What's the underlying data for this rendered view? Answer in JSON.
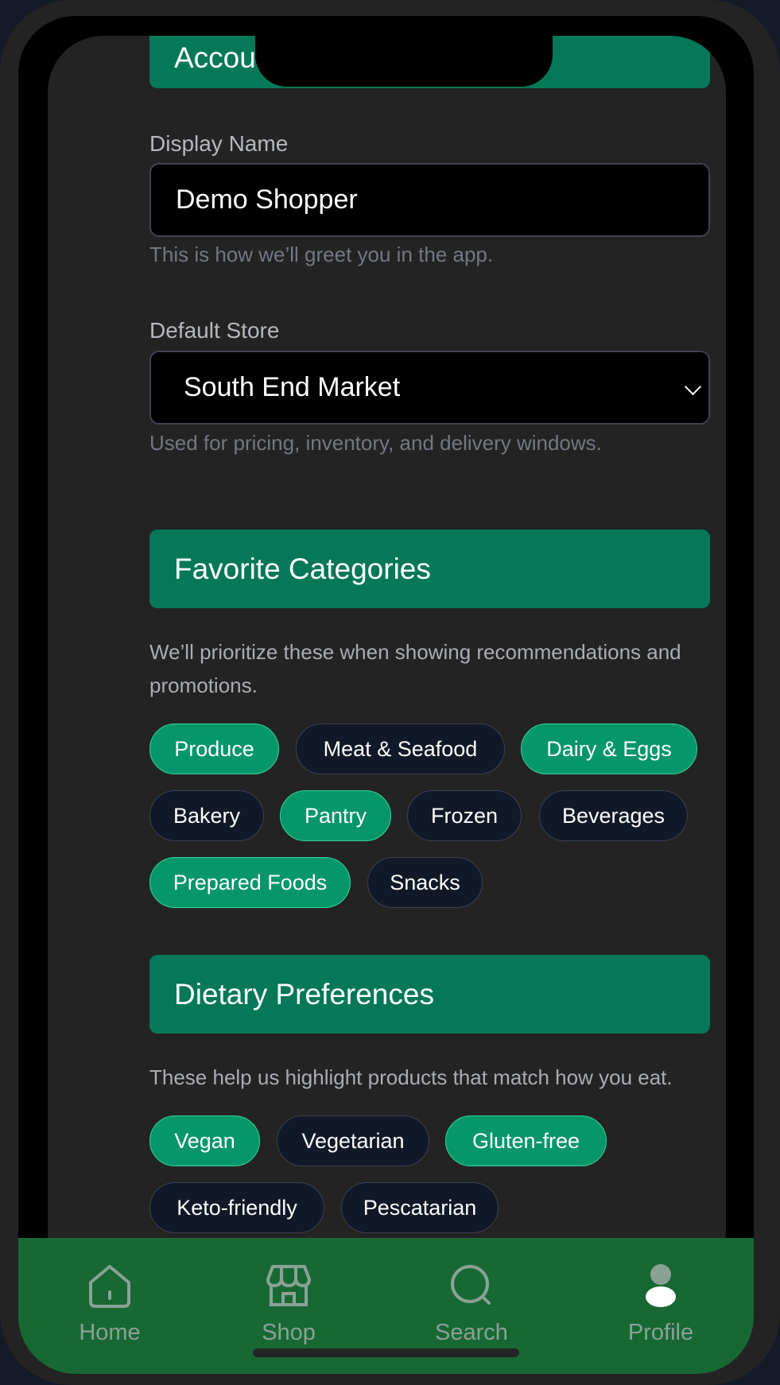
{
  "account": {
    "header_partial": "Account"
  },
  "display_name": {
    "label": "Display Name",
    "value": "Demo Shopper",
    "help": "This is how we’ll greet you in the app."
  },
  "default_store": {
    "label": "Default Store",
    "value": "South End Market",
    "help": "Used for pricing, inventory, and delivery windows."
  },
  "favorite_categories": {
    "title": "Favorite Categories",
    "description": "We’ll prioritize these when showing recommendations and promotions.",
    "chips": [
      {
        "label": "Produce",
        "selected": true
      },
      {
        "label": "Meat & Seafood",
        "selected": false
      },
      {
        "label": "Dairy & Eggs",
        "selected": true
      },
      {
        "label": "Bakery",
        "selected": false
      },
      {
        "label": "Pantry",
        "selected": true
      },
      {
        "label": "Frozen",
        "selected": false
      },
      {
        "label": "Beverages",
        "selected": false
      },
      {
        "label": "Prepared Foods",
        "selected": true
      },
      {
        "label": "Snacks",
        "selected": false
      }
    ]
  },
  "dietary_preferences": {
    "title": "Dietary Preferences",
    "description": "These help us highlight products that match how you eat.",
    "chips": [
      {
        "label": "Vegan",
        "selected": true
      },
      {
        "label": "Vegetarian",
        "selected": false
      },
      {
        "label": "Gluten-free",
        "selected": true
      },
      {
        "label": "Keto-friendly",
        "selected": false
      },
      {
        "label": "Pescatarian",
        "selected": false
      }
    ]
  },
  "nav": {
    "items": [
      {
        "label": "Home",
        "icon": "home-icon"
      },
      {
        "label": "Shop",
        "icon": "store-icon"
      },
      {
        "label": "Search",
        "icon": "search-icon"
      },
      {
        "label": "Profile",
        "icon": "user-icon"
      }
    ]
  },
  "colors": {
    "accent": "#047857",
    "chip_selected": "#059669",
    "chip_unselected": "#111827",
    "nav_bar": "#186834"
  }
}
